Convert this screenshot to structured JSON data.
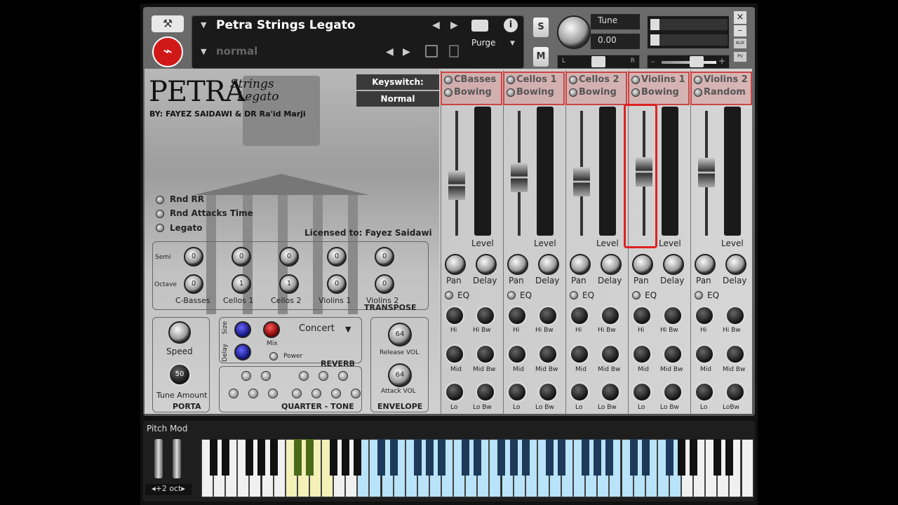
{
  "header": {
    "instrument_name": "Petra Strings Legato",
    "snapshot": "normal",
    "purge_label": "Purge",
    "solo_label": "S",
    "mute_label": "M",
    "tune_label": "Tune",
    "tune_value": "0.00",
    "pan_l": "L",
    "pan_r": "R",
    "aux_label": "AUX",
    "pv_label": "PV",
    "close": "×",
    "minimize": "–"
  },
  "branding": {
    "title": "PETRA",
    "subtitle_1": "Strings",
    "subtitle_2": "Legato",
    "by": "BY: FAYEZ SAIDAWI & DR Ra'id Marji",
    "licensed": "Licensed to: Fayez Saidawi"
  },
  "keyswitch": {
    "label": "Keyswitch:",
    "value": "Normal"
  },
  "options": [
    "Rnd RR",
    "Rnd Attacks Time",
    "Legato"
  ],
  "transpose": {
    "title": "TRANSPOSE",
    "row_semi": "Semi",
    "row_octave": "Octave",
    "semi_values": [
      "0",
      "0",
      "0",
      "0",
      "0"
    ],
    "octave_values": [
      "0",
      "1",
      "1",
      "0",
      "0"
    ],
    "channels": [
      "C-Basses",
      "Cellos 1",
      "Cellos 2",
      "Violins 1",
      "Violins 2"
    ]
  },
  "porta": {
    "title": "PORTA",
    "speed": "Speed",
    "tune_amount": "Tune Amount",
    "tune_value": "50"
  },
  "reverb": {
    "title": "REVERB",
    "size": "Size",
    "delay": "Delay",
    "mix": "Mix",
    "preset": "Concert",
    "power": "Power"
  },
  "quartertone": {
    "title": "QUARTER - TONE"
  },
  "envelope": {
    "title": "ENVELOPE",
    "release": "Release VOL",
    "attack": "Attack VOL",
    "release_value": "64",
    "attack_value": "64"
  },
  "mixer": {
    "strips": [
      {
        "name": "CBasses",
        "art": "Bowing"
      },
      {
        "name": "Cellos 1",
        "art": "Bowing"
      },
      {
        "name": "Cellos 2",
        "art": "Bowing"
      },
      {
        "name": "Violins 1",
        "art": "Bowing"
      },
      {
        "name": "Violins 2",
        "art": "Random"
      }
    ],
    "level": "Level",
    "pan": "Pan",
    "delay": "Delay",
    "eq": "EQ",
    "hi": "Hi",
    "hibw": "Hi Bw",
    "mid": "Mid",
    "midbw": "Mid Bw",
    "lo": "Lo",
    "lobw": "Lo Bw",
    "lobw5": "LoBw"
  },
  "keyboard": {
    "pitch_mod": "Pitch Mod",
    "octave": "+2 oct"
  }
}
